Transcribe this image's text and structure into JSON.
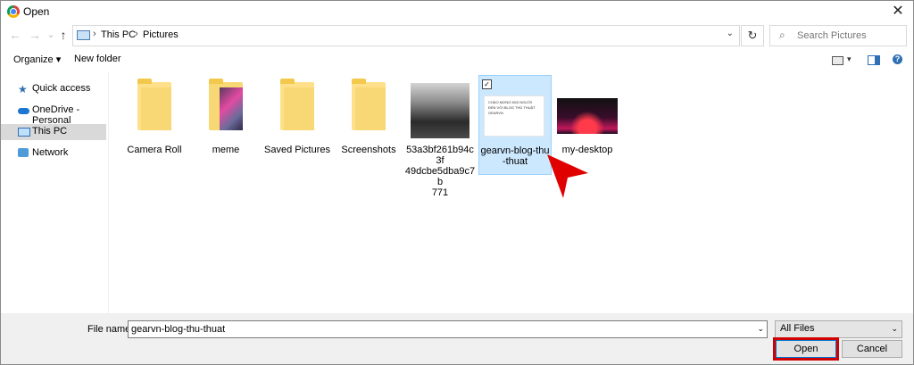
{
  "window": {
    "title": "Open",
    "close_glyph": "✕"
  },
  "nav_buttons": {
    "back": "←",
    "forward": "→",
    "recent": "⌄",
    "up": "↑"
  },
  "address": {
    "segments": [
      "This PC",
      "Pictures"
    ],
    "separator": "›",
    "refresh": "↻",
    "search_placeholder": "Search Pictures"
  },
  "toolbar": {
    "organize": "Organize ▾",
    "new_folder": "New folder"
  },
  "sidebar": {
    "items": [
      {
        "label": "Quick access",
        "icon": "star-icon"
      },
      {
        "label": "OneDrive - Personal",
        "icon": "cloud-icon"
      },
      {
        "label": "This PC",
        "icon": "computer-icon",
        "selected": true
      },
      {
        "label": "Network",
        "icon": "network-icon"
      }
    ]
  },
  "files": [
    {
      "name": "Camera Roll",
      "kind": "folder"
    },
    {
      "name": "meme",
      "kind": "folder-with-images"
    },
    {
      "name": "Saved Pictures",
      "kind": "folder"
    },
    {
      "name": "Screenshots",
      "kind": "folder"
    },
    {
      "name": "53a3bf261b94c3f49dcbe5dabe9c7b771",
      "display": "53a3bf261b94c3f\n49dcbe5dba9c7b\n771",
      "kind": "image"
    },
    {
      "name": "gearvn-blog-thu-thuat",
      "display": "gearvn-blog-thu\n-thuat",
      "kind": "image",
      "selected": true,
      "thumb_text": "CHÀO MỪNG MỌI NGƯỜI ĐẾN VỚI BLOG THỦ THUẬT GEARVN"
    },
    {
      "name": "my-desktop",
      "kind": "image"
    }
  ],
  "footer": {
    "file_name_label": "File name:",
    "file_name_value": "gearvn-blog-thu-thuat",
    "file_type": "All Files",
    "open_label": "Open",
    "cancel_label": "Cancel"
  },
  "colors": {
    "selection": "#cce8ff",
    "accent": "#0078d7",
    "highlight": "#d00000"
  }
}
